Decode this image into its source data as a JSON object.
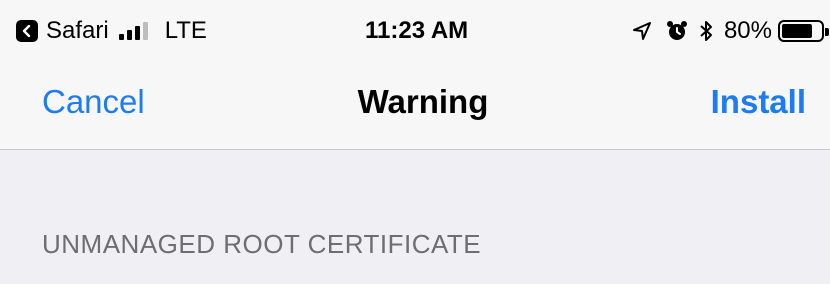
{
  "status_bar": {
    "back_app": "Safari",
    "carrier": "LTE",
    "time": "11:23 AM",
    "battery": "80%",
    "battery_level": 0.8,
    "icons": [
      "back-to-app-icon",
      "signal-icon",
      "location-arrow-icon",
      "alarm-icon",
      "bluetooth-icon",
      "battery-icon"
    ]
  },
  "nav": {
    "cancel_label": "Cancel",
    "title": "Warning",
    "install_label": "Install"
  },
  "section": {
    "header": "UNMANAGED ROOT CERTIFICATE"
  },
  "colors": {
    "accent": "#1e7cf2",
    "background": "#f0eff4",
    "bar": "#f7f7f7",
    "section_text": "#6d6d72"
  }
}
